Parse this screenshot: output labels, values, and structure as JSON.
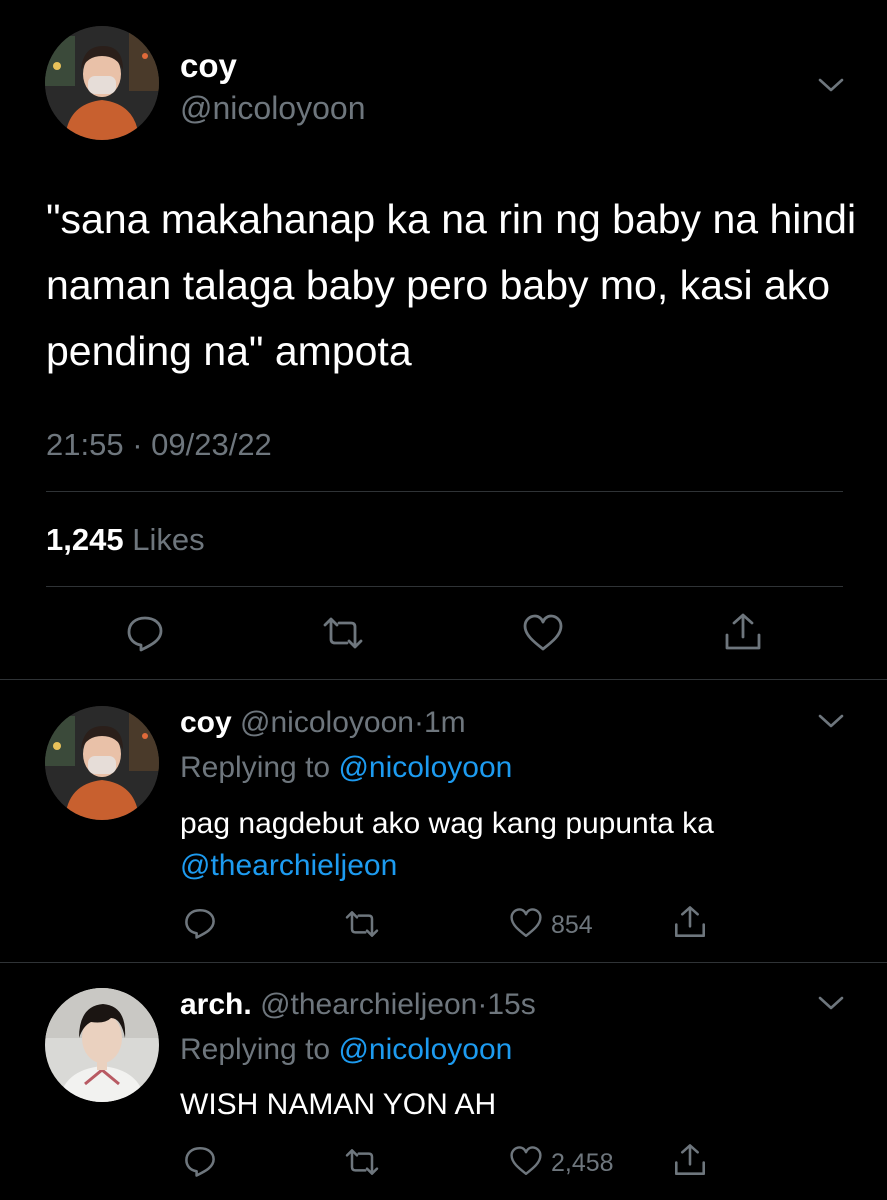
{
  "main_tweet": {
    "name": "coy",
    "handle": "@nicoloyoon",
    "text": "\"sana makahanap ka na rin ng baby na hindi naman talaga baby pero baby mo, kasi ako pending na\" ampota",
    "timestamp": "21:55 · 09/23/22",
    "likes_count": "1,245",
    "likes_label": "Likes",
    "actions": [
      "reply-icon",
      "retweet-icon",
      "like-icon",
      "share-icon"
    ]
  },
  "replies": [
    {
      "name": "coy",
      "handle": "@nicoloyoon",
      "dot": "·",
      "time": "1m",
      "replying_prefix": "Replying to",
      "replying_to": "@nicoloyoon",
      "text": "pag nagdebut ako wag kang pupunta ka",
      "mention": "@thearchieljeon",
      "like_count": "854"
    },
    {
      "name": "arch.",
      "handle": "@thearchieljeon",
      "dot": "·",
      "time": "15s",
      "replying_prefix": "Replying to",
      "replying_to": "@nicoloyoon",
      "text": "WISH NAMAN YON AH",
      "like_count": "2,458"
    }
  ],
  "colors": {
    "background": "#000000",
    "text": "#ffffff",
    "muted": "#6e767d",
    "link": "#1d9bf0",
    "divider": "#2f3336"
  }
}
